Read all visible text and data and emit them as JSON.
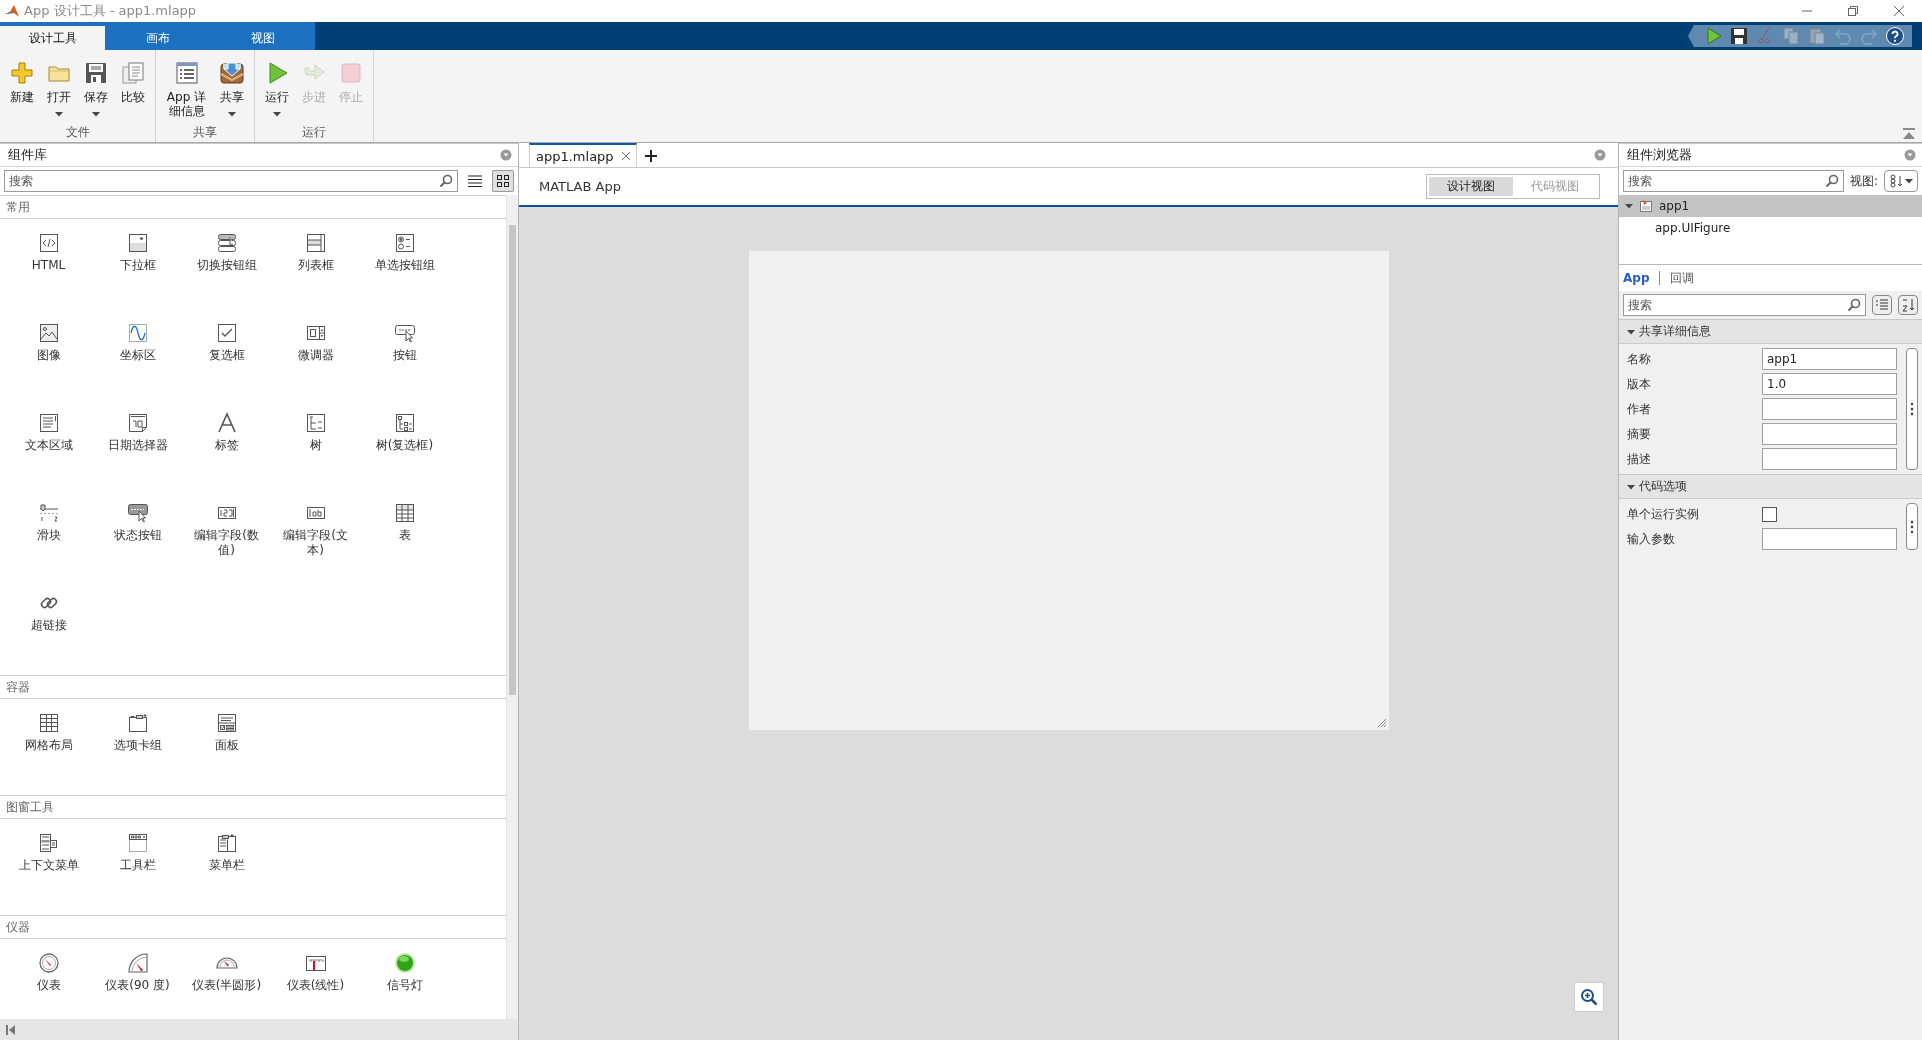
{
  "window": {
    "title": "App 设计工具 - app1.mlapp"
  },
  "tabs": [
    {
      "label": "设计工具",
      "selected": true
    },
    {
      "label": "画布",
      "selected": false
    },
    {
      "label": "视图",
      "selected": false
    }
  ],
  "quick_access": [
    {
      "disabled": false
    },
    {
      "disabled": false
    },
    {
      "disabled": true
    },
    {
      "disabled": true
    },
    {
      "disabled": true
    },
    {
      "disabled": true
    },
    {
      "disabled": true
    },
    {
      "disabled": false
    }
  ],
  "ribbon": {
    "groups": [
      {
        "label": "文件",
        "buttons": [
          {
            "label": "新建",
            "dropdown": false,
            "disabled": false
          },
          {
            "label": "打开",
            "dropdown": true,
            "disabled": false
          },
          {
            "label": "保存",
            "dropdown": true,
            "disabled": false
          },
          {
            "label": "比较",
            "dropdown": false,
            "disabled": false
          }
        ]
      },
      {
        "label": "共享",
        "buttons": [
          {
            "label": "App 详细信息",
            "dropdown": false,
            "disabled": false
          },
          {
            "label": "共享",
            "dropdown": true,
            "disabled": false
          }
        ]
      },
      {
        "label": "运行",
        "buttons": [
          {
            "label": "运行",
            "dropdown": true,
            "disabled": false
          },
          {
            "label": "步进",
            "dropdown": false,
            "disabled": true
          },
          {
            "label": "停止",
            "dropdown": false,
            "disabled": true
          }
        ]
      }
    ]
  },
  "library": {
    "title": "组件库",
    "search": {
      "placeholder": "搜索"
    },
    "view_modes": [
      {
        "selected": false
      },
      {
        "selected": true
      }
    ],
    "sections": [
      {
        "title": "常用",
        "items": [
          {
            "label": "HTML"
          },
          {
            "label": "下拉框"
          },
          {
            "label": "切换按钮组"
          },
          {
            "label": "列表框"
          },
          {
            "label": "单选按钮组"
          },
          {
            "label": "图像"
          },
          {
            "label": "坐标区"
          },
          {
            "label": "复选框"
          },
          {
            "label": "微调器"
          },
          {
            "label": "按钮"
          },
          {
            "label": "文本区域"
          },
          {
            "label": "日期选择器"
          },
          {
            "label": "标签"
          },
          {
            "label": "树"
          },
          {
            "label": "树(复选框)"
          },
          {
            "label": "滑块"
          },
          {
            "label": "状态按钮"
          },
          {
            "label": "编辑字段(数值)"
          },
          {
            "label": "编辑字段(文本)"
          },
          {
            "label": "表"
          },
          {
            "label": "超链接"
          }
        ]
      },
      {
        "title": "容器",
        "items": [
          {
            "label": "网格布局"
          },
          {
            "label": "选项卡组"
          },
          {
            "label": "面板"
          }
        ]
      },
      {
        "title": "图窗工具",
        "items": [
          {
            "label": "上下文菜单"
          },
          {
            "label": "工具栏"
          },
          {
            "label": "菜单栏"
          }
        ]
      },
      {
        "title": "仪器",
        "items": [
          {
            "label": "仪表"
          },
          {
            "label": "仪表(90 度)"
          },
          {
            "label": "仪表(半圆形)"
          },
          {
            "label": "仪表(线性)"
          },
          {
            "label": "信号灯"
          }
        ]
      }
    ]
  },
  "editor": {
    "tabs": [
      {
        "label": "app1.mlapp",
        "selected": true
      }
    ],
    "app_label": "MATLAB App",
    "views": [
      {
        "label": "设计视图",
        "selected": true
      },
      {
        "label": "代码视图",
        "selected": false
      }
    ]
  },
  "browser": {
    "title": "组件浏览器",
    "search": {
      "placeholder": "搜索"
    },
    "view_label": "视图:",
    "tree": [
      {
        "label": "app1",
        "selected": true,
        "expanded": true,
        "children": [
          {
            "label": "app.UIFigure",
            "selected": false
          }
        ]
      }
    ],
    "inspector_tabs": [
      {
        "label": "App",
        "selected": true
      },
      {
        "label": "回调",
        "selected": false
      }
    ],
    "inspector_search": {
      "placeholder": "搜索"
    },
    "sections": [
      {
        "title": "共享详细信息",
        "expanded": true,
        "properties": [
          {
            "kind": "text",
            "label": "名称",
            "value": "app1"
          },
          {
            "kind": "text",
            "label": "版本",
            "value": "1.0"
          },
          {
            "kind": "text",
            "label": "作者"
          },
          {
            "kind": "text",
            "label": "摘要"
          },
          {
            "kind": "text",
            "label": "描述"
          }
        ]
      },
      {
        "title": "代码选项",
        "expanded": true,
        "properties": [
          {
            "kind": "checkbox",
            "label": "单个运行实例",
            "checked": false
          },
          {
            "kind": "text",
            "label": "输入参数"
          }
        ]
      }
    ]
  }
}
